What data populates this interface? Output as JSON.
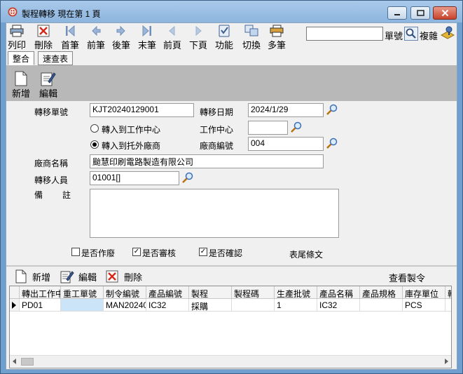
{
  "window": {
    "title": "製程轉移  現在第 1 頁"
  },
  "toolbar": {
    "items": [
      {
        "label": "列印",
        "icon": "printer-icon"
      },
      {
        "label": "刪除",
        "icon": "delete-icon"
      },
      {
        "label": "首筆",
        "icon": "first-record-icon"
      },
      {
        "label": "前筆",
        "icon": "prev-record-icon"
      },
      {
        "label": "後筆",
        "icon": "next-record-icon"
      },
      {
        "label": "末筆",
        "icon": "last-record-icon"
      },
      {
        "label": "前頁",
        "icon": "prev-page-icon"
      },
      {
        "label": "下頁",
        "icon": "next-page-icon"
      },
      {
        "label": "功能",
        "icon": "function-icon"
      },
      {
        "label": "切換",
        "icon": "switch-icon"
      },
      {
        "label": "多筆",
        "icon": "multi-record-icon"
      }
    ],
    "search_value": "",
    "search_label": "單號",
    "copy_label": "複雜"
  },
  "tabs": [
    {
      "label": "整合",
      "active": true
    },
    {
      "label": "速查表",
      "active": false
    }
  ],
  "header_actions": {
    "new_label": "新增",
    "edit_label": "編輯"
  },
  "form": {
    "transfer_no_label": "轉移單號",
    "transfer_no": "KJT20240129001",
    "transfer_date_label": "轉移日期",
    "transfer_date": "2024/1/29",
    "to_work_center_label": "轉入到工作中心",
    "to_work_center_checked": false,
    "work_center_label": "工作中心",
    "work_center": "",
    "to_vendor_label": "轉入到托外廠商",
    "to_vendor_checked": true,
    "vendor_code_label": "廠商編號",
    "vendor_code": "004",
    "vendor_name_label": "廠商名稱",
    "vendor_name": "颱慧印刷電路製造有限公司",
    "transfer_person_label": "轉移人員",
    "transfer_person": "01001[]",
    "remark_label_1": "備",
    "remark_label_2": "註",
    "remark": "",
    "void_label": "是否作廢",
    "void_checked": false,
    "reviewed_label": "是否審核",
    "reviewed_checked": true,
    "confirmed_label": "是否確認",
    "confirmed_checked": true,
    "footer_text_label": "表尾條文"
  },
  "detail_toolbar": {
    "new_label": "新增",
    "edit_label": "編輯",
    "delete_label": "刪除",
    "view_order_label": "查看製令"
  },
  "grid": {
    "columns": [
      "轉出工作中",
      "重工單號",
      "制令編號",
      "產品編號",
      "製程",
      "製程碼",
      "生產批號",
      "產品名稱",
      "產品規格",
      "庫存單位",
      "轉"
    ],
    "rows": [
      [
        "PD01",
        "",
        "MAN20240",
        "IC32",
        "採購",
        "",
        "1",
        "IC32",
        "",
        "PCS",
        ""
      ]
    ]
  },
  "colors": {
    "title_bar": "#8db5de",
    "grid_selected_cell": "#cce4f7"
  }
}
